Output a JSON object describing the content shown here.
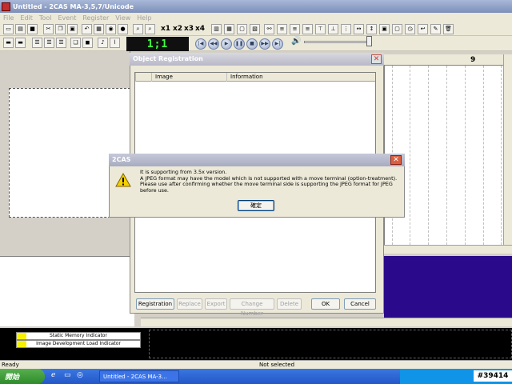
{
  "app": {
    "title": "Untitled - 2CAS MA-3,5,7/Unicode",
    "menu": [
      "File",
      "Edit",
      "Tool",
      "Event",
      "Register",
      "View",
      "Help"
    ],
    "zoom_buttons": [
      "x1",
      "x2",
      "x3",
      "x4"
    ],
    "counter": "1;1"
  },
  "timeline": {
    "header_number": "9"
  },
  "indicators": {
    "static_memory": "Static Memory Indicator",
    "image_load": "Image Development Load Indicator"
  },
  "statusbar": {
    "left": "Ready",
    "center": "Not selected"
  },
  "taskbar": {
    "start": "開始",
    "task_item": "Untitled - 2CAS MA-3...",
    "tray_id": "#39414"
  },
  "object_dialog": {
    "title": "Object Registration",
    "columns": [
      "Image",
      "Information"
    ],
    "buttons": {
      "registration": "Registration",
      "replace": "Replace",
      "export": "Export",
      "change_number": "Change Number",
      "delete": "Delete",
      "ok": "OK",
      "cancel": "Cancel"
    }
  },
  "alert": {
    "title": "2CAS",
    "line1": "It is supporting from 3.5x version.",
    "line2": "A JPEG format may have the model which is not supported with a move terminal (option-treatment).",
    "line3": "Please use after confirming whether the move terminal side is supporting the JPEG format for JPEG before use.",
    "ok_button": "確定"
  },
  "colors": {
    "purple_panel": "#2a0a8a",
    "counter_text": "#40ff40",
    "indicator_swatch": "#f5f000"
  }
}
